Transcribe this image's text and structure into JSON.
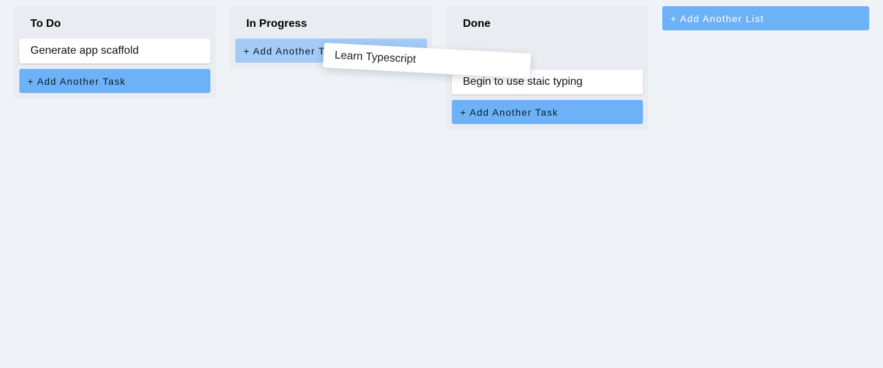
{
  "lists": [
    {
      "title": "To Do",
      "cards": [
        "Generate app scaffold"
      ],
      "add_task_label": "+ Add Another Task"
    },
    {
      "title": "In Progress",
      "cards": [],
      "add_task_label": "+ Add Another Task"
    },
    {
      "title": "Done",
      "cards": [
        "Begin to use staic typing"
      ],
      "add_task_label": "+ Add Another Task"
    }
  ],
  "add_list_label": "+ Add Another List",
  "dragging_card": {
    "text": "Learn Typescript"
  },
  "colors": {
    "background": "#eff3f7",
    "list_background": "#e9ecf0",
    "accent": "#6db2f7",
    "accent_faded": "#a3cbf5",
    "card": "#ffffff"
  }
}
